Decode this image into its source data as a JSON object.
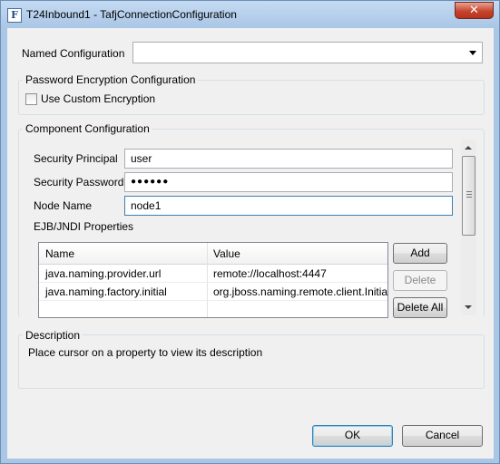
{
  "window": {
    "title": "T24Inbound1 - TafjConnectionConfiguration",
    "close_glyph": "✕",
    "app_icon_letter": "F"
  },
  "named_configuration": {
    "label": "Named Configuration",
    "value": ""
  },
  "password_encryption": {
    "title": "Password Encryption Configuration",
    "use_custom_label": "Use Custom Encryption",
    "checked": false
  },
  "component": {
    "title": "Component Configuration",
    "security_principal": {
      "label": "Security Principal",
      "value": "user"
    },
    "security_password": {
      "label": "Security Password",
      "value": "●●●●●●"
    },
    "node_name": {
      "label": "Node Name",
      "value": "node1"
    },
    "ejb_label": "EJB/JNDI Properties",
    "table": {
      "columns": [
        "Name",
        "Value"
      ],
      "rows": [
        {
          "name": "java.naming.provider.url",
          "value": "remote://localhost:4447"
        },
        {
          "name": "java.naming.factory.initial",
          "value": "org.jboss.naming.remote.client.InitialContextFactory"
        }
      ]
    },
    "buttons": {
      "add": "Add",
      "delete": "Delete",
      "delete_all": "Delete All"
    }
  },
  "description": {
    "title": "Description",
    "text": "Place cursor on a property to view its description"
  },
  "footer": {
    "ok": "OK",
    "cancel": "Cancel"
  }
}
